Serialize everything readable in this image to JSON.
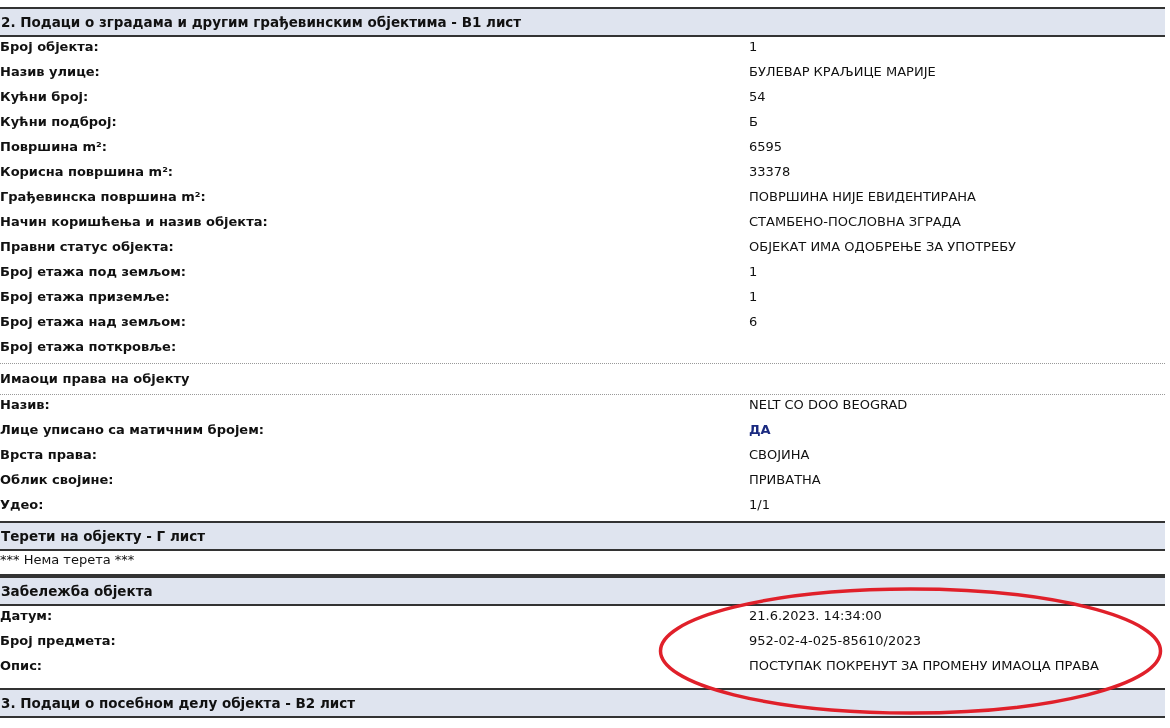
{
  "blocks": [
    {
      "kind": "section_header",
      "text": "2. Подаци о зградама и другим грађевинским објектима - В1 лист"
    },
    {
      "kind": "field_rows",
      "rows": [
        {
          "label": "Број објекта:",
          "value": "1",
          "kind": "plain"
        },
        {
          "label": "Назив улице:",
          "value": "БУЛЕВАР КРАЉИЦЕ МАРИЈЕ",
          "kind": "plain"
        },
        {
          "label": "Кућни број:",
          "value": "54",
          "kind": "plain"
        },
        {
          "label": "Кућни подброј:",
          "value": "Б",
          "kind": "plain"
        },
        {
          "label": "Површина m²:",
          "value": "6595",
          "kind": "plain"
        },
        {
          "label": "Корисна површина m²:",
          "value": "33378",
          "kind": "plain"
        },
        {
          "label": "Грађевинска површина m²:",
          "value": "ПОВРШИНА НИЈЕ ЕВИДЕНТИРАНА",
          "kind": "plain"
        },
        {
          "label": "Начин коришћења и назив објекта:",
          "value": "СТАМБЕНО-ПОСЛОВНА ЗГРАДА",
          "kind": "plain"
        },
        {
          "label": "Правни статус објекта:",
          "value": "ОБЈЕКАТ ИМА ОДОБРЕЊЕ ЗА УПОТРЕБУ",
          "kind": "plain"
        },
        {
          "label": "Број етажа под земљом:",
          "value": "1",
          "kind": "plain"
        },
        {
          "label": "Број етажа приземље:",
          "value": "1",
          "kind": "plain"
        },
        {
          "label": "Број етажа над земљом:",
          "value": "6",
          "kind": "plain"
        },
        {
          "label": "Број етажа поткровље:"
        }
      ]
    },
    {
      "kind": "subheading",
      "text": "Имаоци права на објекту"
    },
    {
      "kind": "field_rows",
      "rows": [
        {
          "label": "Назив:",
          "value": "NELT CO DOO BEOGRAD",
          "kind": "plain"
        },
        {
          "label": "Лице уписано са матичним бројем:",
          "value": "ДА",
          "kind": "emphasis"
        },
        {
          "label": "Врста права:",
          "value": "СВОЈИНА",
          "kind": "plain"
        },
        {
          "label": "Облик својине:",
          "value": "ПРИВАТНА",
          "kind": "plain"
        },
        {
          "label": "Удео:",
          "value": "1/1",
          "kind": "plain"
        }
      ]
    },
    {
      "kind": "section_header",
      "text": "Терети на објекту - Г лист"
    },
    {
      "kind": "note",
      "text": "*** Нема терета ***"
    },
    {
      "kind": "section_header",
      "text": "Забележба објекта"
    },
    {
      "kind": "field_rows",
      "circled": true,
      "rows": [
        {
          "label": "Датум:",
          "value": "21.6.2023. 14:34:00",
          "kind": "plain"
        },
        {
          "label": "Број предмета:",
          "value": "952-02-4-025-85610/2023",
          "kind": "plain"
        },
        {
          "label": "Опис:",
          "value": "ПОСТУПАК ПОКРЕНУТ ЗА ПРОМЕНУ ИМАОЦА ПРАВА",
          "kind": "plain"
        }
      ]
    },
    {
      "kind": "section_header",
      "text": "3. Подаци о посебном делу објекта - В2 лист"
    }
  ]
}
